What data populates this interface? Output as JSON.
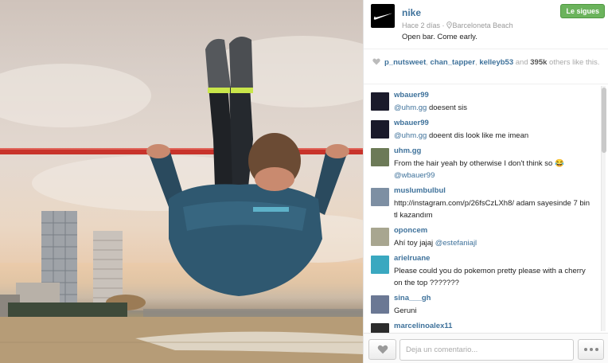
{
  "post": {
    "username": "nike",
    "time": "Hace 2 días",
    "separator": "·",
    "location": "Barceloneta Beach",
    "caption": "Open bar. Come early.",
    "follow_label": "Le sigues",
    "avatar_icon": "nike-swoosh-icon"
  },
  "likes": {
    "users": [
      "p_nutsweet",
      "chan_tapper",
      "kelleyb53"
    ],
    "sep1": ", ",
    "sep2": ", ",
    "and_text": " and ",
    "count": "395k",
    "others_text": " others like this."
  },
  "comments": [
    {
      "user": "wbauer99",
      "mention": "@uhm.gg",
      "text": " doesent sis",
      "avatar_color": "#1a1a2a"
    },
    {
      "user": "wbauer99",
      "mention": "@uhm.gg",
      "text": " doeent dis look like me imean",
      "avatar_color": "#1a1a2a"
    },
    {
      "user": "uhm.gg",
      "text": "From the hair yeah by otherwise I don't think so 😂",
      "mention_after": "@wbauer99",
      "avatar_color": "#6c7a57"
    },
    {
      "user": "muslumbulbul",
      "text": "http://instagram.com/p/26fsCzLXh8/ adam sayesinde 7 bin tl kazandım",
      "avatar_color": "#7d8fa3"
    },
    {
      "user": "oponcem",
      "text": "Ahí toy jajaj ",
      "mention_after": "@estefaniajl",
      "avatar_color": "#a8a690"
    },
    {
      "user": "arielruane",
      "text": "Please could you do pokemon pretty please with a cherry on the top ???????",
      "avatar_color": "#3aa8c0"
    },
    {
      "user": "sina___gh",
      "text": "Geruni",
      "avatar_color": "#6b7894"
    },
    {
      "user": "marcelinoalex11",
      "text": "",
      "avatar_color": "#2c2c2c"
    }
  ],
  "footer": {
    "comment_placeholder": "Deja un comentario...",
    "like_icon": "heart-icon",
    "more_icon": "ellipsis-icon"
  },
  "colors": {
    "link_blue": "#3f729b",
    "follow_green": "#6bb35c"
  }
}
